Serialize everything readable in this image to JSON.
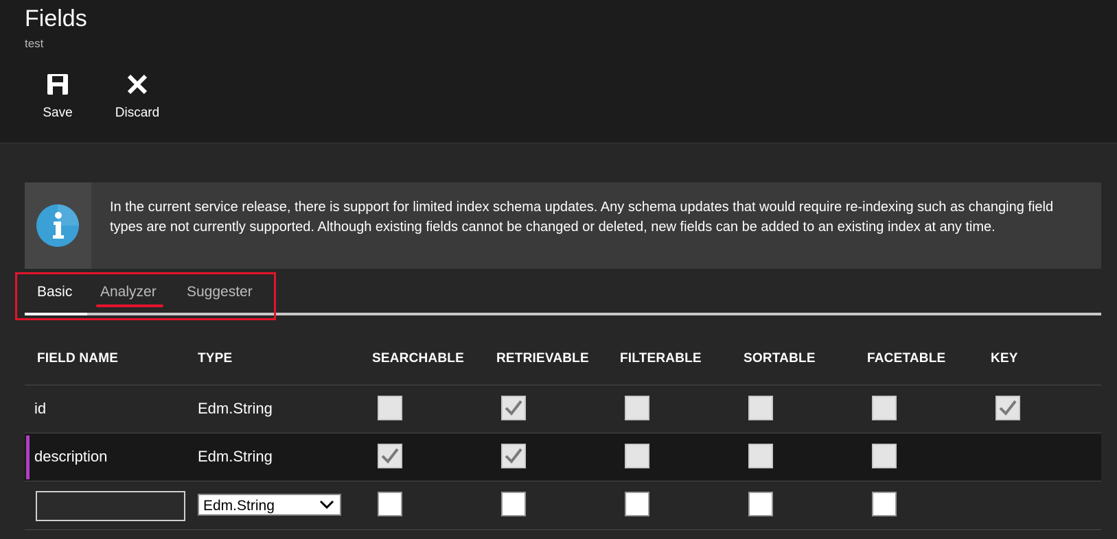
{
  "header": {
    "title": "Fields",
    "subtitle": "test"
  },
  "commands": {
    "save_label": "Save",
    "discard_label": "Discard"
  },
  "info": {
    "text": "In the current service release, there is support for limited index schema updates. Any schema updates that would require re-indexing such as changing field types are not currently supported. Although existing fields cannot be changed or deleted, new fields can be added to an existing index at any time."
  },
  "tabs": [
    {
      "label": "Basic",
      "active": true
    },
    {
      "label": "Analyzer",
      "active": false
    },
    {
      "label": "Suggester",
      "active": false
    }
  ],
  "columns": [
    "FIELD NAME",
    "TYPE",
    "SEARCHABLE",
    "RETRIEVABLE",
    "FILTERABLE",
    "SORTABLE",
    "FACETABLE",
    "KEY"
  ],
  "rows": [
    {
      "name": "id",
      "type": "Edm.String",
      "searchable": false,
      "retrievable": true,
      "filterable": false,
      "sortable": false,
      "facetable": false,
      "key": true
    },
    {
      "name": "description",
      "type": "Edm.String",
      "searchable": true,
      "retrievable": true,
      "filterable": false,
      "sortable": false,
      "facetable": false,
      "key": null,
      "selected": true
    }
  ],
  "new_row": {
    "name_value": "",
    "type_value": "Edm.String"
  },
  "colors": {
    "accent": "#b23fc4",
    "highlight": "#e3142b",
    "info_icon": "#3aa0d6"
  }
}
